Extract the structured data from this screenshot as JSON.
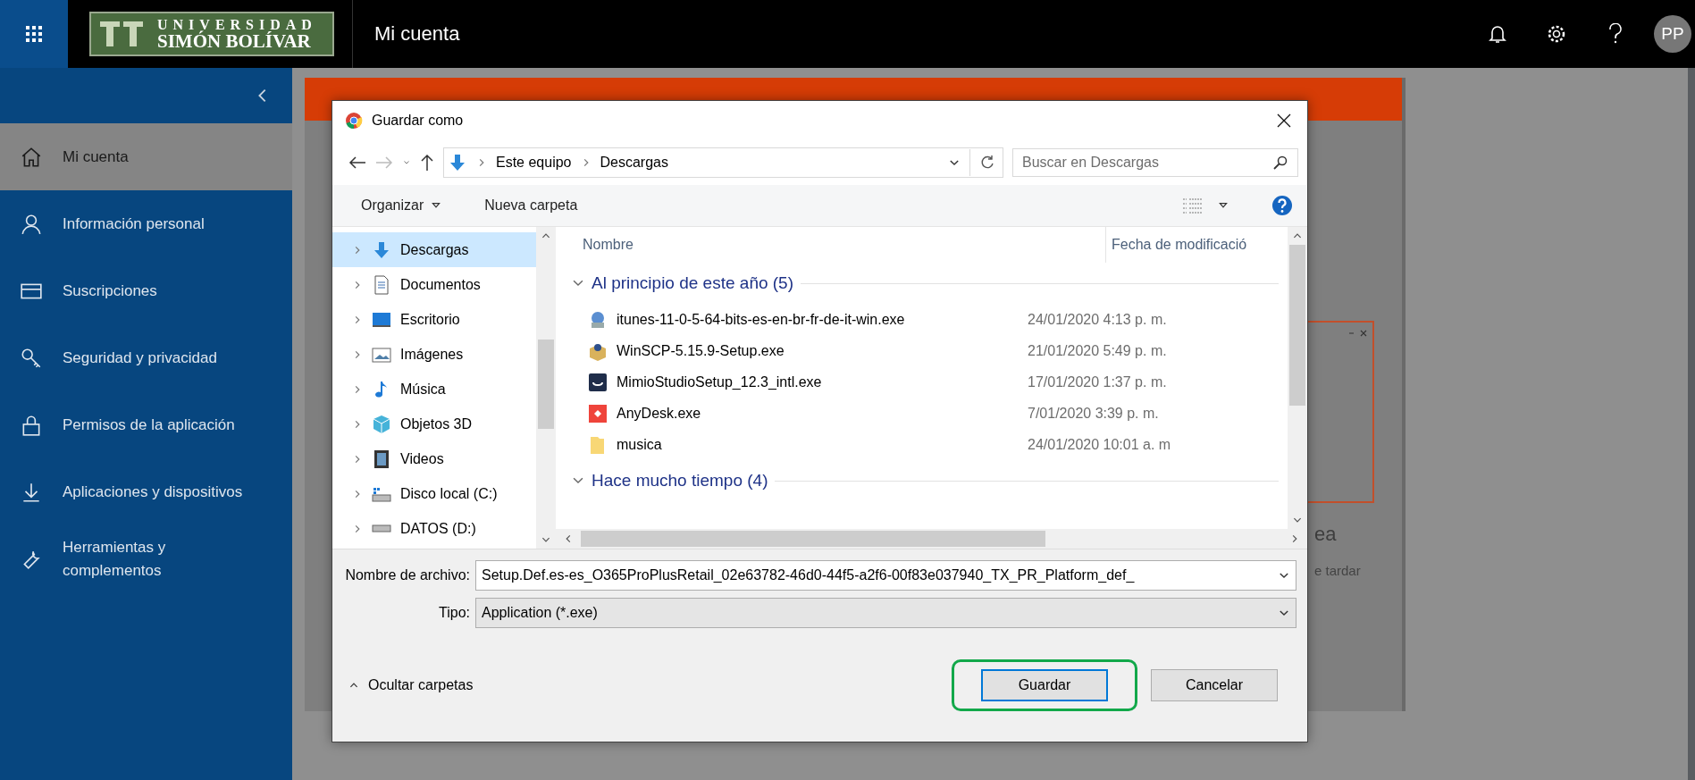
{
  "app_bar": {
    "logo_line1": "UNIVERSIDAD",
    "logo_line2": "SIMÓN BOLÍVAR",
    "title": "Mi cuenta",
    "avatar": "PP"
  },
  "sidebar": {
    "items": [
      {
        "label": "Mi cuenta",
        "selected": true,
        "kind": "home"
      },
      {
        "label": "Información personal",
        "selected": false,
        "kind": "person"
      },
      {
        "label": "Suscripciones",
        "selected": false,
        "kind": "card"
      },
      {
        "label": "Seguridad y privacidad",
        "selected": false,
        "kind": "key"
      },
      {
        "label": "Permisos de la aplicación",
        "selected": false,
        "kind": "lock"
      },
      {
        "label": "Aplicaciones y dispositivos",
        "selected": false,
        "kind": "download"
      },
      {
        "label": "Herramientas y complementos",
        "selected": false,
        "kind": "wrench"
      }
    ]
  },
  "background_page": {
    "heading_fragment": "ea",
    "text_fragment": "e tardar"
  },
  "dialog": {
    "title": "Guardar como",
    "breadcrumb": [
      "Este equipo",
      "Descargas"
    ],
    "search": {
      "placeholder": "Buscar en Descargas"
    },
    "toolbar": {
      "organize": "Organizar",
      "new_folder": "Nueva carpeta"
    },
    "nav": [
      {
        "label": "Descargas",
        "selected": true,
        "kind": "downloads"
      },
      {
        "label": "Documentos",
        "selected": false,
        "kind": "documents"
      },
      {
        "label": "Escritorio",
        "selected": false,
        "kind": "desktop"
      },
      {
        "label": "Imágenes",
        "selected": false,
        "kind": "pictures"
      },
      {
        "label": "Música",
        "selected": false,
        "kind": "music"
      },
      {
        "label": "Objetos 3D",
        "selected": false,
        "kind": "objects"
      },
      {
        "label": "Videos",
        "selected": false,
        "kind": "videos"
      },
      {
        "label": "Disco local (C:)",
        "selected": false,
        "kind": "system-drive"
      },
      {
        "label": "DATOS (D:)",
        "selected": false,
        "kind": "drive"
      }
    ],
    "columns": [
      "Nombre",
      "Fecha de modificació"
    ],
    "groups": [
      {
        "title": "Al principio de este año (5)",
        "expanded": true,
        "files": [
          {
            "name": "itunes-11-0-5-64-bits-es-en-br-fr-de-it-win.exe",
            "date": "24/01/2020 4:13 p. m.",
            "kind": "installer"
          },
          {
            "name": "WinSCP-5.15.9-Setup.exe",
            "date": "21/01/2020 5:49 p. m.",
            "kind": "package"
          },
          {
            "name": "MimioStudioSetup_12.3_intl.exe",
            "date": "17/01/2020 1:37 p. m.",
            "kind": "app-dark"
          },
          {
            "name": "AnyDesk.exe",
            "date": "7/01/2020 3:39 p. m.",
            "kind": "app-red"
          },
          {
            "name": "musica",
            "date": "24/01/2020 10:01 a. m",
            "kind": "folder"
          }
        ]
      },
      {
        "title": "Hace mucho tiempo (4)",
        "expanded": true
      }
    ],
    "file_name": {
      "label": "Nombre de archivo:",
      "value": "Setup.Def.es-es_O365ProPlusRetail_02e63782-46d0-44f5-a2f6-00f83e037940_TX_PR_Platform_def_"
    },
    "file_type": {
      "label": "Tipo:",
      "value": "Application (*.exe)"
    },
    "hide_folders": "Ocultar carpetas",
    "buttons": [
      {
        "label": "Guardar",
        "kind": "primary",
        "highlighted": true
      },
      {
        "label": "Cancelar",
        "kind": "secondary",
        "highlighted": false
      }
    ]
  }
}
